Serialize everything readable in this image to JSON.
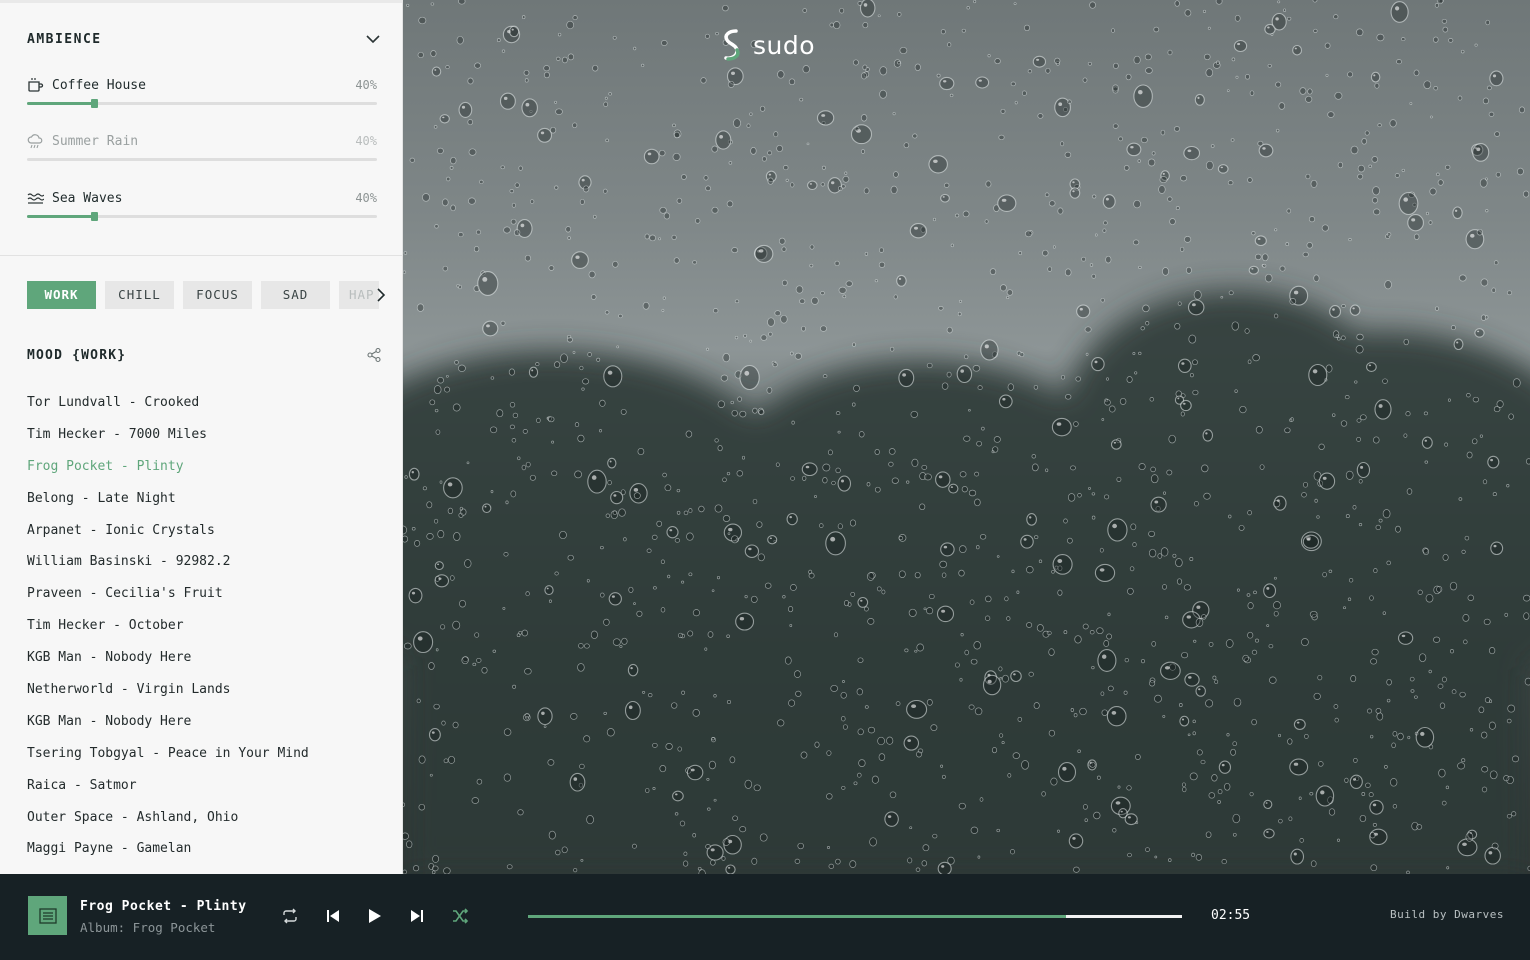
{
  "ambience": {
    "title": "AMBIENCE",
    "sounds": [
      {
        "name": "Coffee House",
        "percent": "40%",
        "level": 0.19,
        "active": true,
        "icon": "coffee-cup-icon"
      },
      {
        "name": "Summer Rain",
        "percent": "40%",
        "level": 0.19,
        "active": false,
        "icon": "rain-cloud-icon"
      },
      {
        "name": "Sea Waves",
        "percent": "40%",
        "level": 0.19,
        "active": true,
        "icon": "waves-icon"
      }
    ]
  },
  "moods": {
    "tabs": [
      "WORK",
      "CHILL",
      "FOCUS",
      "SAD",
      "HAP"
    ],
    "active_tab": "WORK"
  },
  "playlist": {
    "title": "MOOD {WORK}",
    "tracks": [
      "Tor Lundvall - Crooked",
      "Tim Hecker - 7000 Miles",
      "Frog Pocket - Plinty",
      "Belong - Late Night",
      "Arpanet - Ionic Crystals",
      "William Basinski - 92982.2",
      "Praveen - Cecilia's Fruit",
      "Tim Hecker - October",
      "KGB Man - Nobody Here",
      "Netherworld - Virgin Lands",
      "KGB Man - Nobody Here",
      "Tsering Tobgyal - Peace in Your Mind",
      "Raica - Satmor",
      "Outer Space - Ashland, Ohio",
      "Maggi Payne - Gamelan"
    ],
    "current_index": 2
  },
  "brand": {
    "name": "sudo"
  },
  "player": {
    "title": "Frog Pocket - Plinty",
    "album": "Album: Frog Pocket",
    "elapsed": "02:55",
    "progress": 0.823,
    "credit": "Build by Dwarves"
  },
  "colors": {
    "accent": "#5fa67b",
    "player_bg": "#172125",
    "sidebar_bg": "#f7f7f7"
  }
}
